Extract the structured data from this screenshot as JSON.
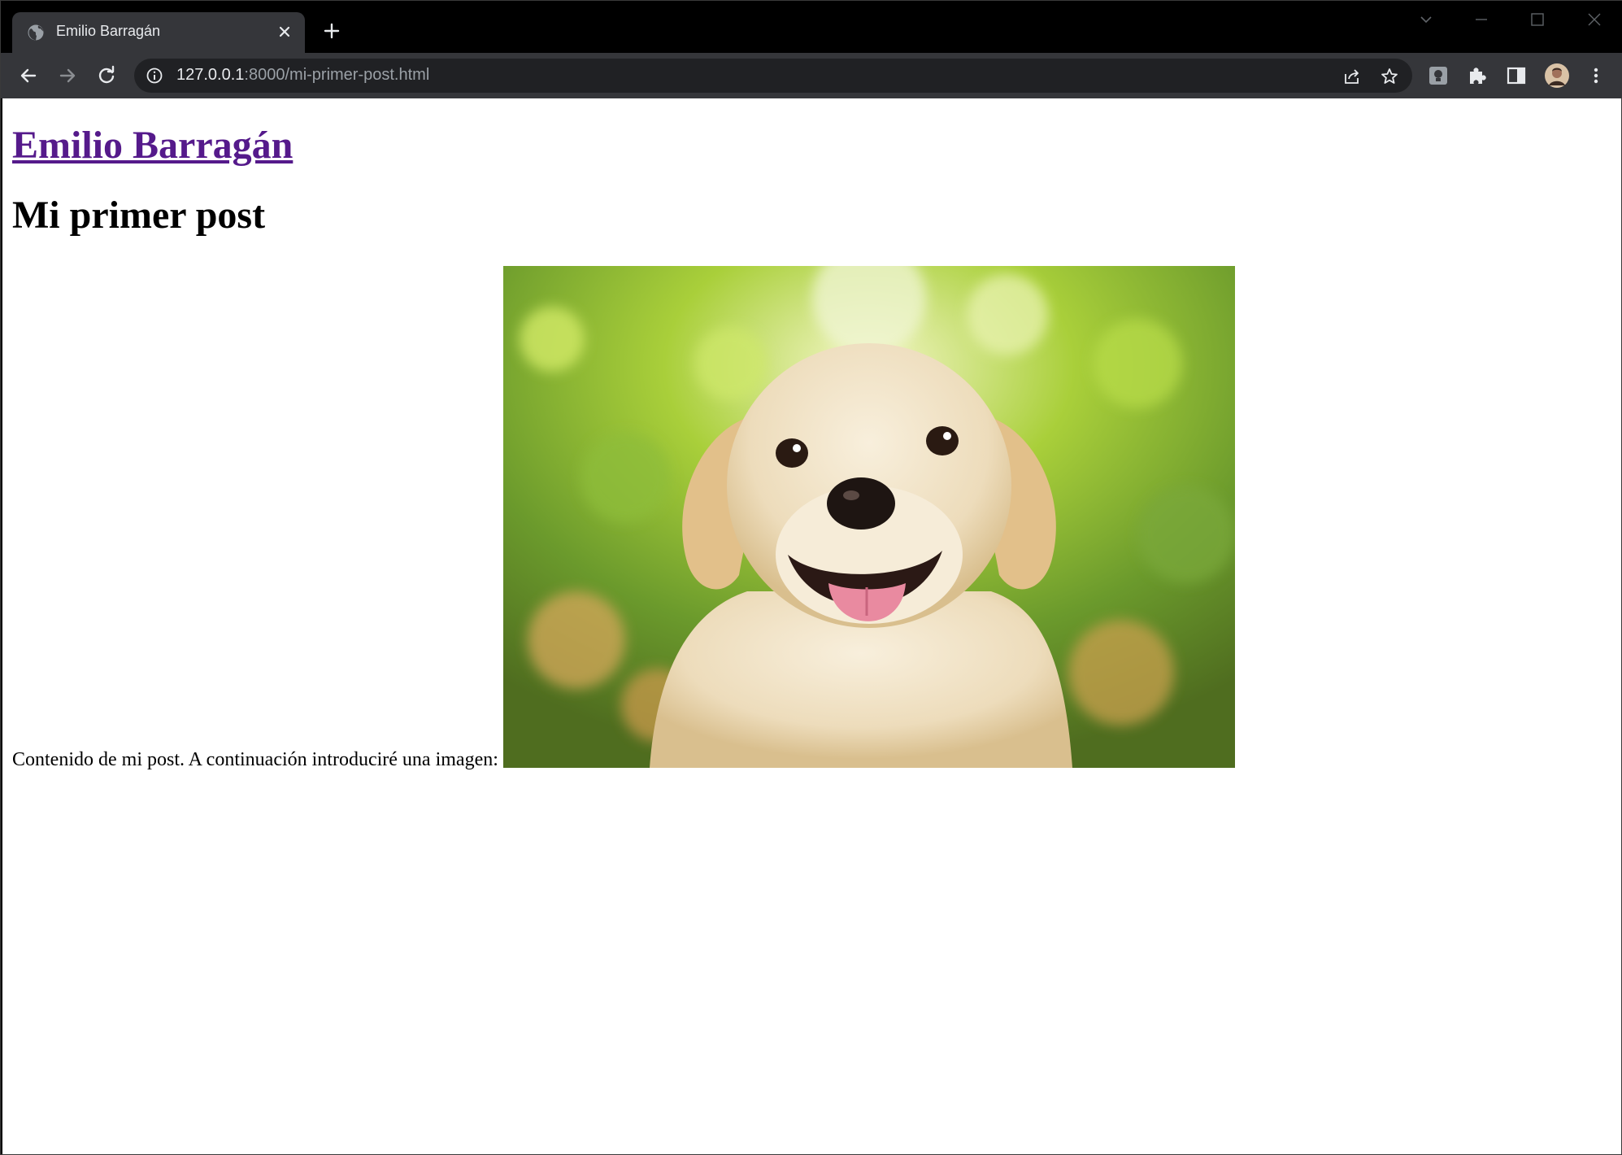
{
  "browser": {
    "tab": {
      "title": "Emilio Barragán",
      "favicon": "globe-icon",
      "close_icon": "close-icon"
    },
    "new_tab_icon": "plus-icon",
    "address_bar": {
      "host": "127.0.0.1",
      "rest": ":8000/mi-primer-post.html",
      "info_icon": "info-icon"
    },
    "toolbar_icons": [
      "back-icon",
      "forward-icon",
      "reload-icon",
      "share-icon",
      "bookmark-star-icon",
      "extension-icon",
      "puzzle-icon",
      "side-panel-icon",
      "avatar",
      "menu-icon"
    ]
  },
  "page": {
    "site_title": "Emilio Barragán",
    "post_title": "Mi primer post",
    "post_text": "Contenido de mi post. A continuación introduciré una imagen:",
    "image_subject": "puppy-photo"
  },
  "colors": {
    "link_visited": "#551a8b",
    "tab_bg": "#35363a",
    "omnibox_bg": "#202124"
  }
}
